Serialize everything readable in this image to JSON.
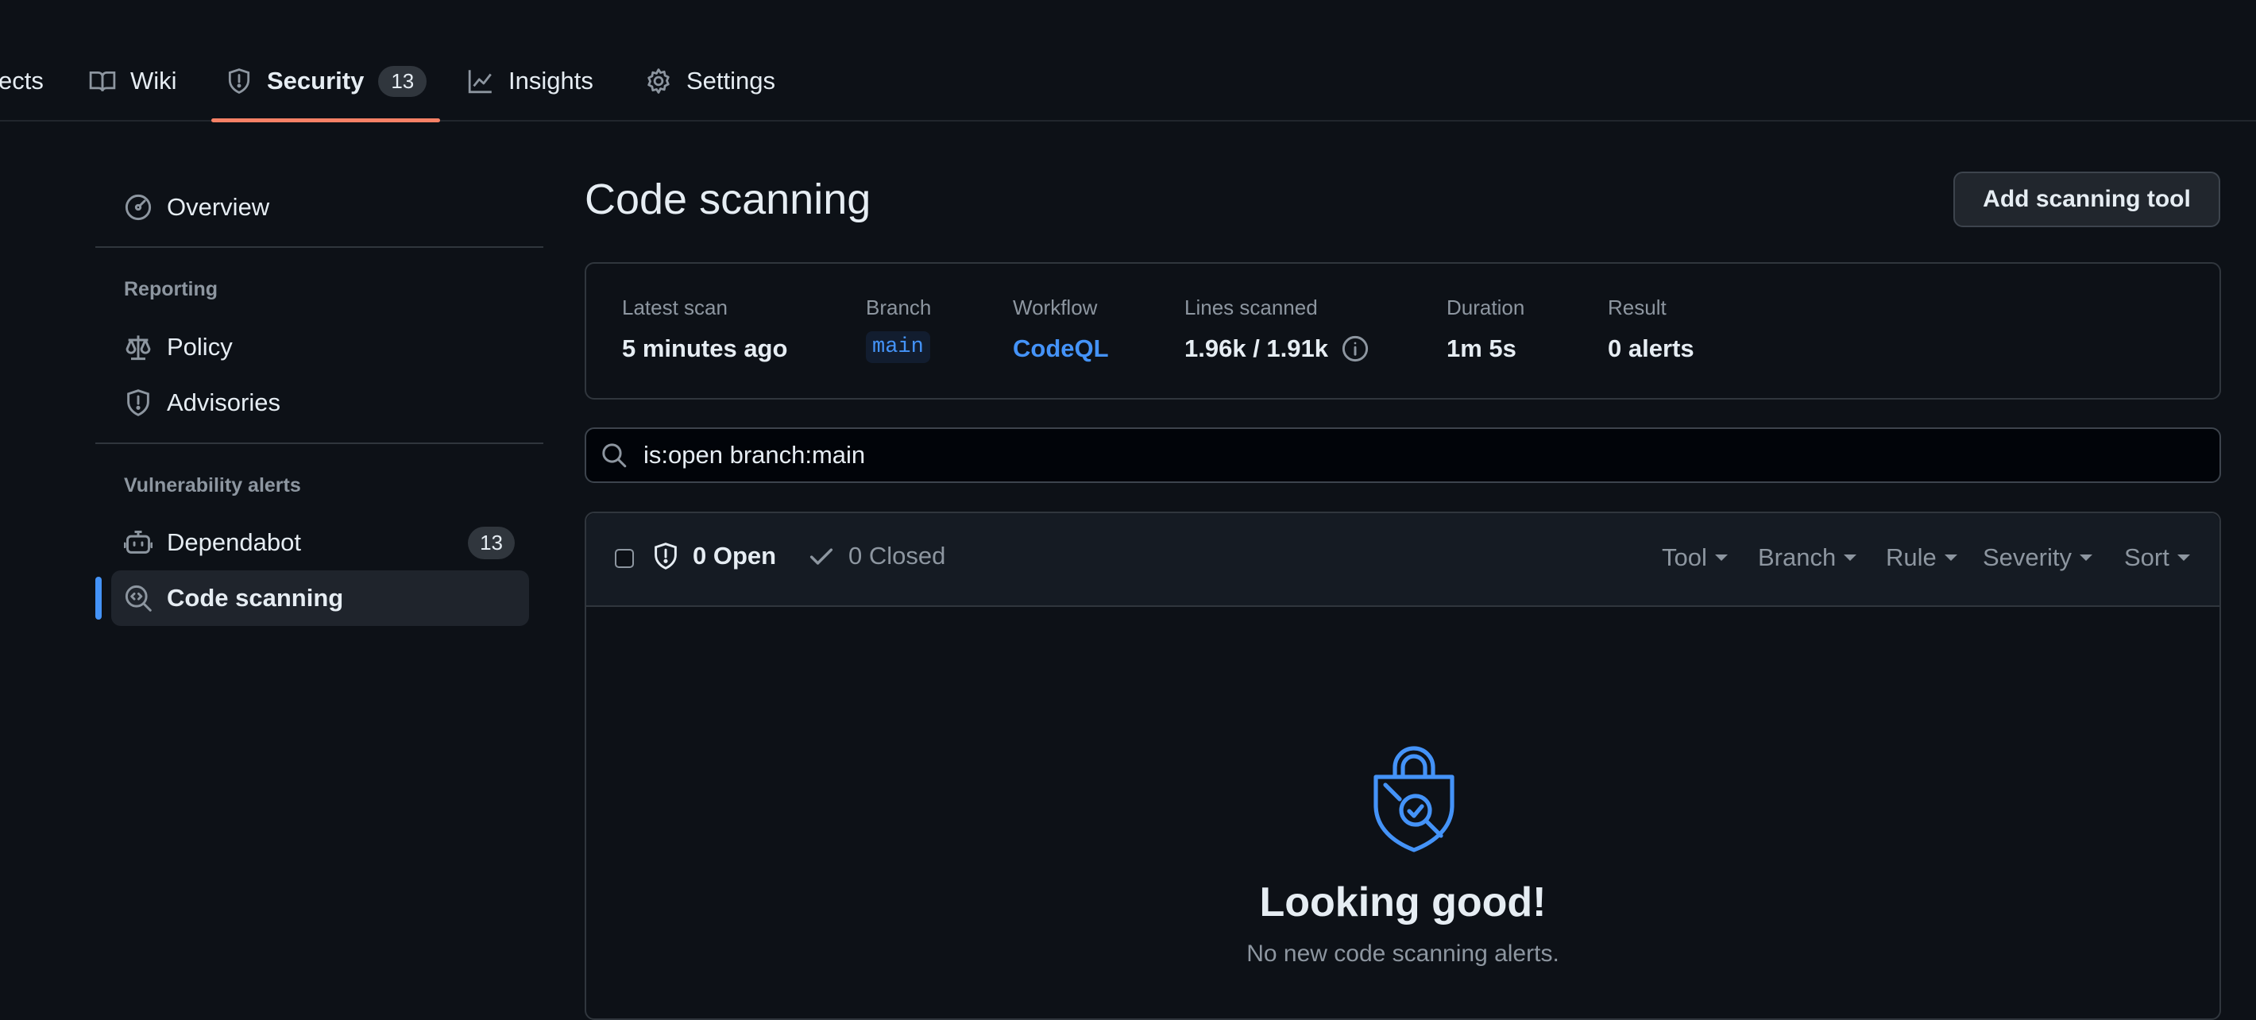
{
  "nav": {
    "tabs": [
      {
        "label": "ects"
      },
      {
        "label": "Wiki"
      },
      {
        "label": "Security",
        "count": "13"
      },
      {
        "label": "Insights"
      },
      {
        "label": "Settings"
      }
    ],
    "accent_color": "#f78166"
  },
  "sidebar": {
    "overview": "Overview",
    "reporting_heading": "Reporting",
    "policy": "Policy",
    "advisories": "Advisories",
    "vuln_heading": "Vulnerability alerts",
    "dependabot": "Dependabot",
    "dependabot_count": "13",
    "code_scanning": "Code scanning"
  },
  "main": {
    "title": "Code scanning",
    "add_button": "Add scanning tool",
    "scan": {
      "latest_scan_label": "Latest scan",
      "latest_scan_value": "5 minutes ago",
      "branch_label": "Branch",
      "branch_value": "main",
      "workflow_label": "Workflow",
      "workflow_value": "CodeQL",
      "lines_label": "Lines scanned",
      "lines_value": "1.96k / 1.91k",
      "duration_label": "Duration",
      "duration_value": "1m 5s",
      "result_label": "Result",
      "result_value": "0 alerts"
    },
    "search": {
      "value": "is:open branch:main"
    },
    "alerts": {
      "open_label": "0 Open",
      "closed_label": "0 Closed",
      "filters": [
        "Tool",
        "Branch",
        "Rule",
        "Severity",
        "Sort"
      ],
      "empty_title": "Looking good!",
      "empty_subtitle": "No new code scanning alerts."
    }
  },
  "colors": {
    "background": "#0d1117",
    "link": "#4493f8",
    "muted": "#8d96a0"
  }
}
